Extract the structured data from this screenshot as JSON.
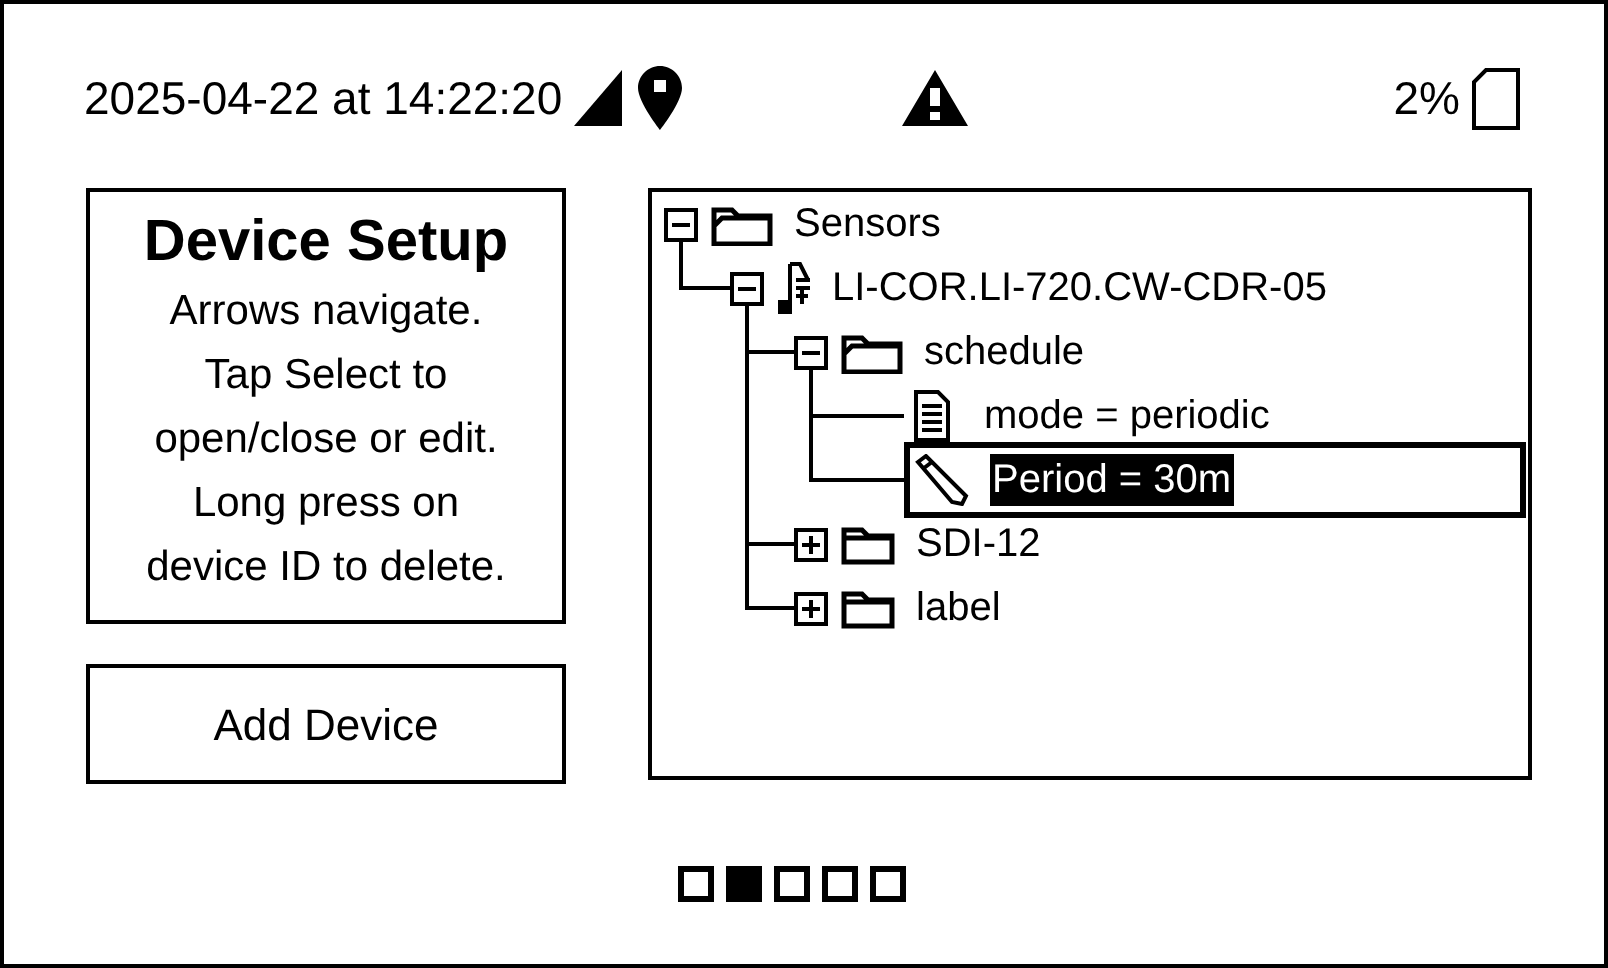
{
  "status_bar": {
    "datetime": "2025-04-22 at 14:22:20",
    "battery": "2%"
  },
  "info_panel": {
    "title": "Device Setup",
    "text": "Arrows navigate.\nTap Select to\nopen/close or edit.\nLong press on\ndevice ID to delete."
  },
  "add_button": {
    "label": "Add Device"
  },
  "tree": [
    {
      "kind": "folder",
      "label": "Sensors",
      "expanded": true,
      "selected": false,
      "children": [
        {
          "kind": "device",
          "label": "LI-COR.LI-720.CW-CDR-05",
          "expanded": true,
          "selected": false,
          "children": [
            {
              "kind": "folder",
              "label": "schedule",
              "expanded": true,
              "selected": false,
              "children": [
                {
                  "kind": "setting",
                  "label": "mode = periodic",
                  "selected": false
                },
                {
                  "kind": "edit",
                  "label": "Period = 30m",
                  "selected": true
                }
              ]
            },
            {
              "kind": "folder",
              "label": "SDI-12",
              "expanded": false,
              "selected": false
            },
            {
              "kind": "folder",
              "label": "label",
              "expanded": false,
              "selected": false
            }
          ]
        }
      ]
    }
  ],
  "pages": [
    {
      "selected": false
    },
    {
      "selected": true
    },
    {
      "selected": false
    },
    {
      "selected": false
    },
    {
      "selected": false
    }
  ]
}
